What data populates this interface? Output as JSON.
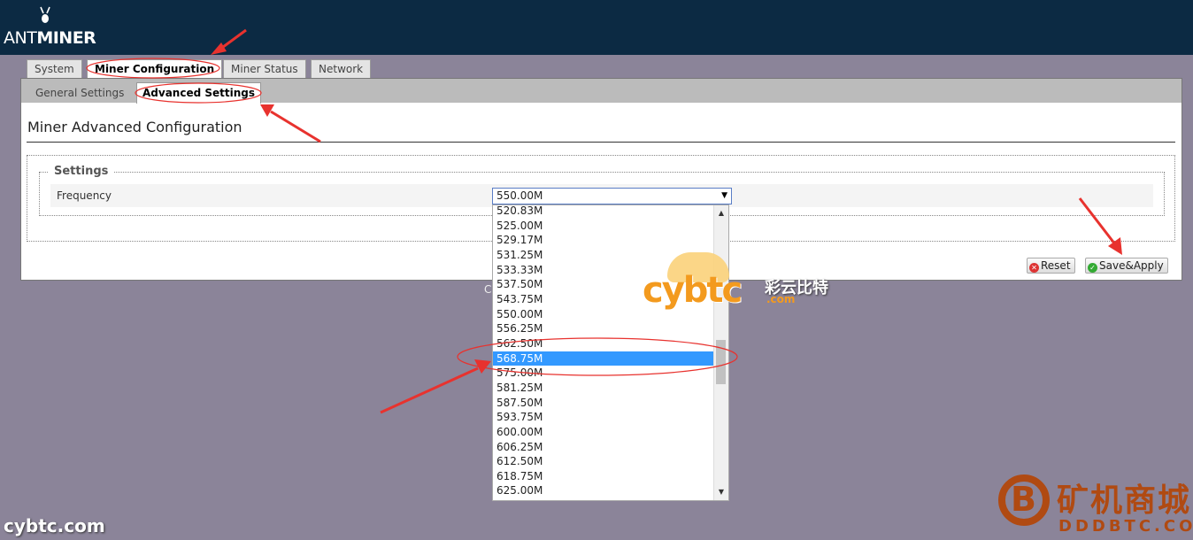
{
  "header": {
    "brand_prefix": "ANT",
    "brand_suffix": "MINER"
  },
  "tabs": [
    {
      "label": "System"
    },
    {
      "label": "Miner Configuration"
    },
    {
      "label": "Miner Status"
    },
    {
      "label": "Network"
    }
  ],
  "subtabs": [
    {
      "label": "General Settings"
    },
    {
      "label": "Advanced Settings"
    }
  ],
  "page": {
    "title": "Miner Advanced Configuration",
    "legend": "Settings",
    "field_label": "Frequency",
    "selected_value": "550.00M"
  },
  "buttons": {
    "reset": "Reset",
    "apply": "Save&Apply"
  },
  "footer_text": "C",
  "dropdown": {
    "options": [
      "520.83M",
      "525.00M",
      "529.17M",
      "531.25M",
      "533.33M",
      "537.50M",
      "543.75M",
      "550.00M",
      "556.25M",
      "562.50M",
      "568.75M",
      "575.00M",
      "581.25M",
      "587.50M",
      "593.75M",
      "600.00M",
      "606.25M",
      "612.50M",
      "618.75M",
      "625.00M"
    ],
    "highlighted": "568.75M"
  },
  "watermarks": {
    "left": "cybtc.com",
    "logo_text": "cybtc",
    "logo_com": ".com",
    "logo_cn": "彩云比特",
    "btc_cn": "矿机商城",
    "btc_en": "DDDBTC.COM",
    "btc_symbol": "B"
  },
  "colors": {
    "header_bg": "#0c2a43",
    "page_bg": "#8b8499",
    "highlight": "#3399ff",
    "annotation": "#e8322e"
  }
}
